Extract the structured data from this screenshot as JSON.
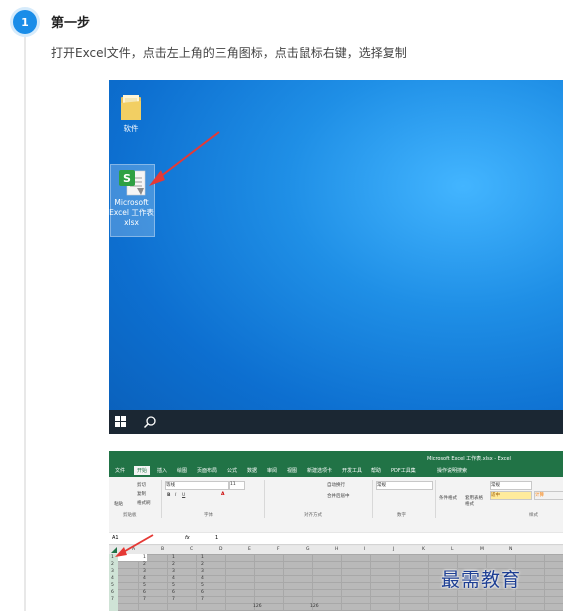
{
  "step": {
    "number": "1",
    "title": "第一步",
    "description": "打开Excel文件，点击左上角的三角图标，点击鼠标右键，选择复制"
  },
  "desktop": {
    "icons": [
      {
        "label": "软件"
      },
      {
        "label_lines": [
          "Microsoft",
          "Excel 工作表",
          "xlsx"
        ]
      }
    ]
  },
  "excel": {
    "title": "Microsoft Excel 工作表.xlsx - Excel",
    "tabs": [
      "文件",
      "开始",
      "插入",
      "绘图",
      "页面布局",
      "公式",
      "数据",
      "审阅",
      "视图",
      "新建选项卡",
      "开发工具",
      "帮助",
      "PDF工具集",
      "操作说明搜索"
    ],
    "active_tab": "开始",
    "ribbon": {
      "paste": "粘贴",
      "cut": "剪切",
      "copy": "复制",
      "format_painter": "格式刷",
      "font_name": "等线",
      "font_size": "11",
      "wrap_text": "自动换行",
      "merge_center": "合并后居中",
      "number_format": "常规",
      "conditional_format": "条件格式",
      "table_format": "套用表格格式",
      "style_normal": "常规",
      "style_good": "适中",
      "style_calc": "计算",
      "groups": [
        "剪贴板",
        "字体",
        "对齐方式",
        "数字",
        "样式"
      ]
    },
    "name_box": "A1",
    "formula_value": "1",
    "columns": [
      "A",
      "B",
      "C",
      "D",
      "E",
      "F",
      "G",
      "H",
      "I",
      "J",
      "K",
      "L",
      "M",
      "N"
    ],
    "rows": [
      "1",
      "2",
      "3",
      "4",
      "5",
      "6",
      "7"
    ],
    "cells": {
      "col_a": [
        "1",
        "2",
        "3",
        "4",
        "5",
        "6",
        "7"
      ],
      "col_b": [
        "1",
        "2",
        "3",
        "4",
        "5",
        "6",
        "7"
      ],
      "col_c": [
        "1",
        "2",
        "3",
        "4",
        "5",
        "6",
        "7"
      ],
      "e7": "126",
      "g7": "126"
    }
  },
  "watermark": "最需教育",
  "colors": {
    "accent": "#1a8de8",
    "excel_green": "#217346",
    "arrow_red": "#e53935"
  }
}
